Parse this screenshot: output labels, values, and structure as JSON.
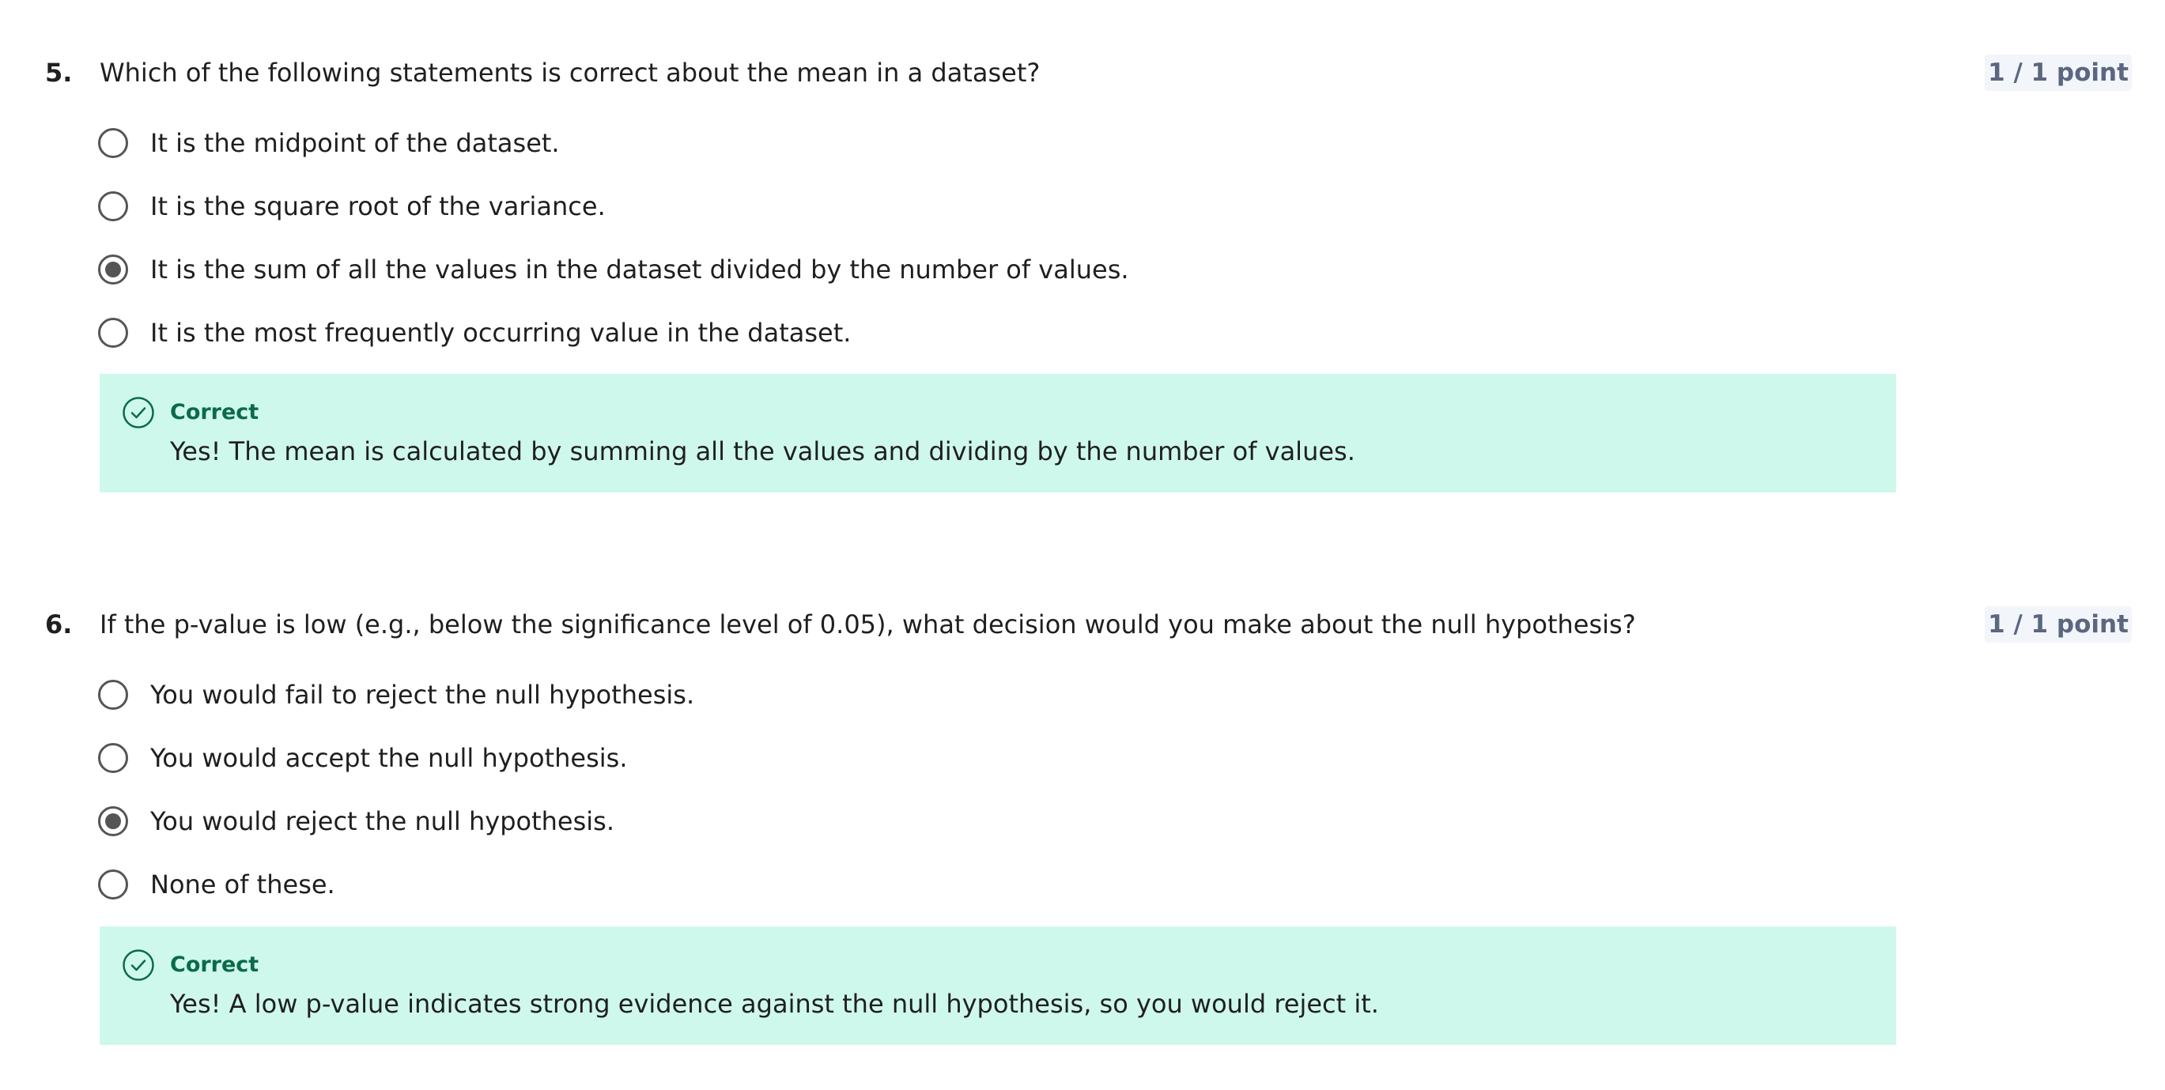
{
  "questions": [
    {
      "number": "5.",
      "text": "Which of the following statements is correct about the mean in a dataset?",
      "points": "1 / 1 point",
      "options": [
        {
          "label": "It is the midpoint of the dataset.",
          "selected": false
        },
        {
          "label": "It is the square root of the variance.",
          "selected": false
        },
        {
          "label": "It is the sum of all the values in the dataset divided by the number of values.",
          "selected": true
        },
        {
          "label": "It is the most frequently occurring value in the dataset.",
          "selected": false
        }
      ],
      "feedback": {
        "status": "Correct",
        "text": "Yes! The mean is calculated by summing all the values and dividing by the number of values."
      }
    },
    {
      "number": "6.",
      "text": "If the p-value is low (e.g., below the significance level of 0.05), what decision would you make about the null hypothesis?",
      "points": "1 / 1 point",
      "options": [
        {
          "label": "You would fail to reject the null hypothesis.",
          "selected": false
        },
        {
          "label": "You would accept the null hypothesis.",
          "selected": false
        },
        {
          "label": "You would reject the null hypothesis.",
          "selected": true
        },
        {
          "label": "None of these.",
          "selected": false
        }
      ],
      "feedback": {
        "status": "Correct",
        "text": "Yes! A low p-value indicates strong evidence against the null hypothesis, so you would reject it."
      }
    }
  ],
  "colors": {
    "feedback_bg": "#cff8ec",
    "correct_green": "#0a6b4a",
    "points_bg": "#f2f5fa",
    "points_text": "#5b6780",
    "radio": "#555555"
  },
  "icons": {
    "feedback": "check-circle-icon"
  }
}
